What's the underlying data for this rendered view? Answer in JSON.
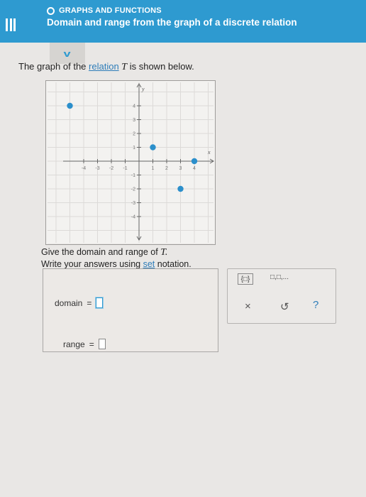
{
  "header": {
    "topic": "GRAPHS AND FUNCTIONS",
    "title": "Domain and range from the graph of a discrete relation"
  },
  "intro": {
    "prefix": "The graph of the",
    "link": "relation",
    "variable": "T",
    "suffix": "is shown below."
  },
  "graph": {
    "axis_x_label": "x",
    "axis_y_label": "y",
    "x_ticks": [
      "-4",
      "-3",
      "-2",
      "-1",
      "1",
      "2",
      "3",
      "4"
    ],
    "y_ticks": [
      "4",
      "3",
      "2",
      "1",
      "-1",
      "-2",
      "-3",
      "-4"
    ],
    "points": [
      {
        "x": -5,
        "y": 4
      },
      {
        "x": 1,
        "y": 1
      },
      {
        "x": 4,
        "y": 0
      },
      {
        "x": 3,
        "y": -2
      }
    ],
    "point_color": "#2b8fcb"
  },
  "instructions": {
    "line1_prefix": "Give the domain and range of",
    "line1_var": "T.",
    "line2_prefix": "Write your answers using",
    "line2_link": "set",
    "line2_suffix": "notation."
  },
  "answers": {
    "domain_label": "domain",
    "range_label": "range",
    "equals": "="
  },
  "toolbox": {
    "set_symbol": "{□}",
    "list_symbol": "□,□,...",
    "clear_symbol": "×",
    "undo_symbol": "↺",
    "help_symbol": "?"
  },
  "colors": {
    "header": "#2e9ad0",
    "link": "#2e7db9"
  }
}
